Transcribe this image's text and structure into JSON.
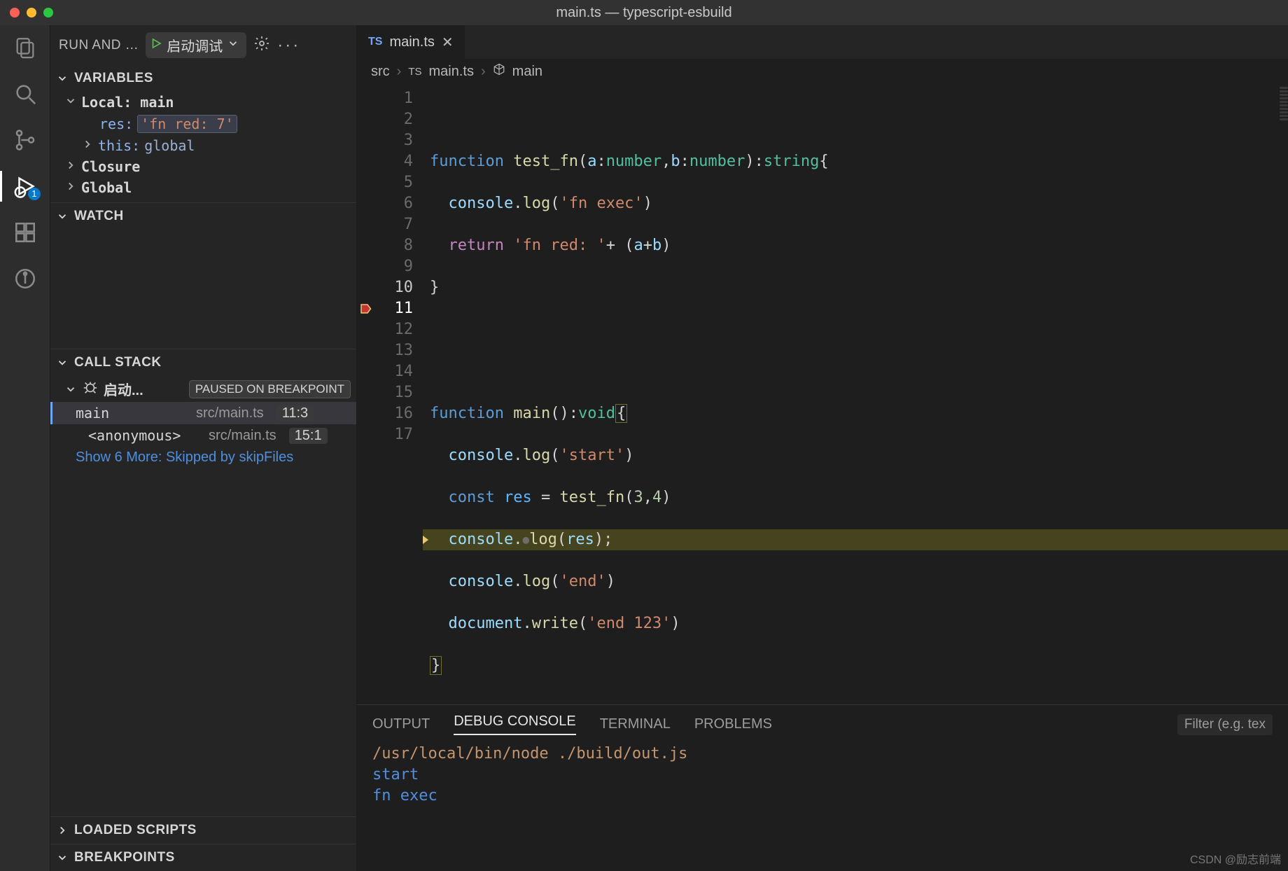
{
  "titlebar": {
    "title": "main.ts — typescript-esbuild"
  },
  "activitybar": {
    "badge": "1"
  },
  "sidebar": {
    "title": "RUN AND …",
    "launch_label": "启动调试",
    "sections": {
      "variables": "VARIABLES",
      "watch": "WATCH",
      "callstack": "CALL STACK",
      "loaded": "LOADED SCRIPTS",
      "breakpoints": "BREAKPOINTS"
    },
    "variables": {
      "scope_local": "Local: main",
      "res_name": "res:",
      "res_value": "'fn red: 7'",
      "this_name": "this:",
      "this_value": "global",
      "closure": "Closure",
      "global": "Global"
    },
    "callstack": {
      "config": "启动...",
      "paused": "PAUSED ON BREAKPOINT",
      "frames": [
        {
          "fn": "main",
          "path": "src/main.ts",
          "pos": "11:3"
        },
        {
          "fn": "<anonymous>",
          "path": "src/main.ts",
          "pos": "15:1"
        }
      ],
      "skip": "Show 6 More: Skipped by skipFiles"
    }
  },
  "editor": {
    "tab_label": "main.ts",
    "breadcrumb": {
      "src": "src",
      "file": "main.ts",
      "symbol": "main"
    },
    "line_numbers": [
      "1",
      "2",
      "3",
      "4",
      "5",
      "6",
      "7",
      "8",
      "9",
      "10",
      "11",
      "12",
      "13",
      "14",
      "15",
      "16",
      "17"
    ],
    "code": {
      "l2": {
        "kw": "function",
        "fn": "test_fn",
        "a": "a",
        "num": "number",
        "b": "b",
        "ret": "string"
      },
      "l3": {
        "obj": "console",
        "m": "log",
        "s": "'fn exec'"
      },
      "l4": {
        "kw": "return",
        "s": "'fn red: '",
        "plus": "+",
        "a": "a",
        "b": "b"
      },
      "l8": {
        "kw": "function",
        "fn": "main",
        "ret": "void"
      },
      "l9": {
        "obj": "console",
        "m": "log",
        "s": "'start'"
      },
      "l10": {
        "kw": "const",
        "v": "res",
        "fn": "test_fn",
        "a": "3",
        "b": "4"
      },
      "l11": {
        "obj": "console",
        "m": "log",
        "v": "res"
      },
      "l12": {
        "obj": "console",
        "m": "log",
        "s": "'end'"
      },
      "l13": {
        "obj": "document",
        "m": "write",
        "s": "'end 123'"
      },
      "l16": {
        "fn": "main"
      }
    }
  },
  "panel": {
    "tabs": {
      "output": "OUTPUT",
      "debug": "DEBUG CONSOLE",
      "terminal": "TERMINAL",
      "problems": "PROBLEMS"
    },
    "filter_placeholder": "Filter (e.g. tex",
    "lines": {
      "cmd": "/usr/local/bin/node ./build/out.js",
      "l1": "start",
      "l2": "fn exec"
    }
  },
  "watermark": "CSDN @励志前端"
}
